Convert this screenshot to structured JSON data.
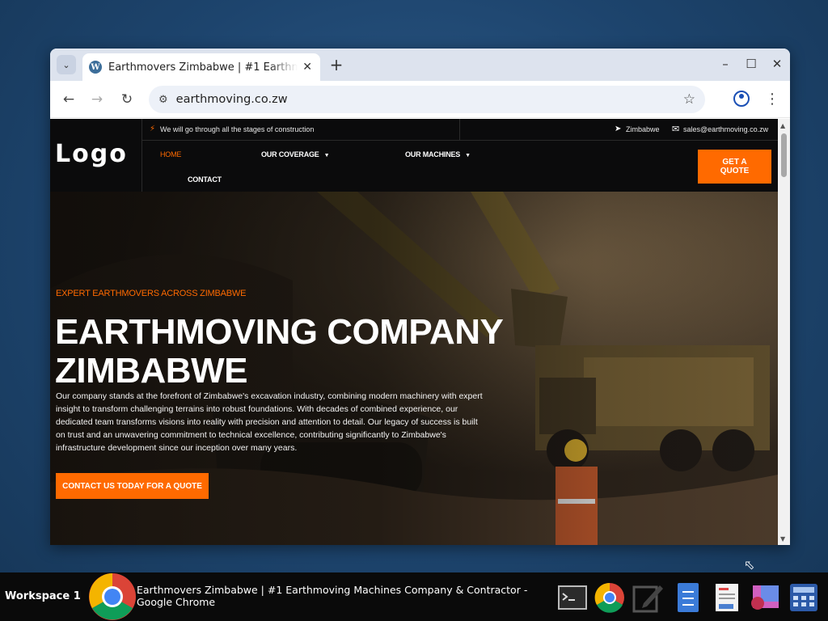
{
  "browser": {
    "tab_title": "Earthmovers Zimbabwe | #1 Earthmoving Machines Company & Contractor",
    "url": "earthmoving.co.zw",
    "tab_list_icon": "chevron-down-icon",
    "new_tab_label": "+"
  },
  "site": {
    "logo": "Logo",
    "topbar": {
      "tagline": "We will go through all the stages of construction",
      "location": "Zimbabwe",
      "email": "sales@earthmoving.co.zw"
    },
    "nav": {
      "home": "HOME",
      "coverage": "OUR COVERAGE",
      "machines": "OUR MACHINES",
      "contact": "CONTACT"
    },
    "quote_button": "GET A QUOTE",
    "accent_color": "#ff6a00",
    "hero": {
      "eyebrow": "EXPERT EARTHMOVERS ACROSS ZIMBABWE",
      "title": "EARTHMOVING COMPANY ZIMBABWE",
      "text": "Our company stands at the forefront of Zimbabwe's excavation industry, combining modern machinery with expert insight to transform challenging terrains into robust foundations. With decades of combined experience, our dedicated team transforms visions into reality with precision and attention to detail. Our legacy of success is built on trust and an unwavering commitment to technical excellence, contributing significantly to Zimbabwe's infrastructure development since our inception over many years.",
      "cta": "CONTACT US TODAY FOR A QUOTE"
    }
  },
  "taskbar": {
    "workspace": "Workspace 1",
    "active_window_title": "Earthmovers Zimbabwe | #1 Earthmoving Machines Company & Contractor - Google Chrome",
    "tray_icons": [
      "terminal-icon",
      "chrome-icon",
      "text-editor-icon",
      "file-manager-icon",
      "document-viewer-icon",
      "image-viewer-icon",
      "calculator-icon"
    ]
  }
}
